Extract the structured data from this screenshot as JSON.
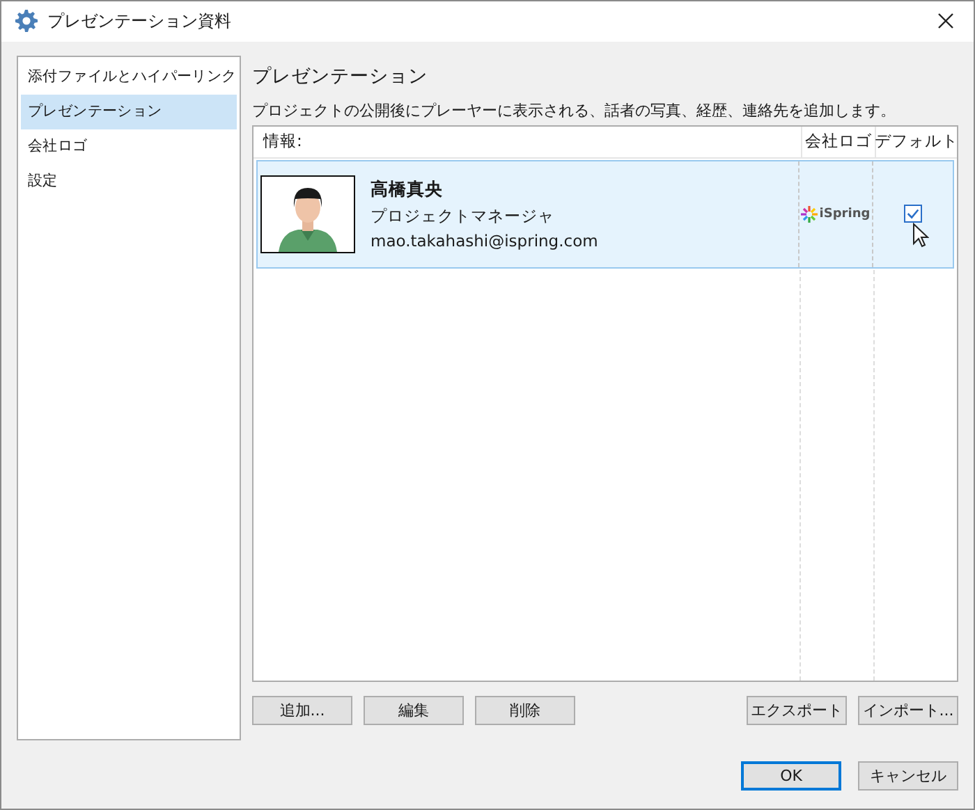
{
  "window": {
    "title": "プレゼンテーション資料"
  },
  "sidebar": {
    "items": [
      {
        "label": "添付ファイルとハイパーリンク",
        "selected": false
      },
      {
        "label": "プレゼンテーション",
        "selected": true
      },
      {
        "label": "会社ロゴ",
        "selected": false
      },
      {
        "label": "設定",
        "selected": false
      }
    ]
  },
  "section": {
    "title": "プレゼンテーション",
    "description": "プロジェクトの公開後にプレーヤーに表示される、話者の写真、経歴、連絡先を追加します。"
  },
  "table": {
    "columns": [
      "情報:",
      "会社ロゴ",
      "デフォルト"
    ],
    "rows": [
      {
        "name": "高橋真央",
        "role": "プロジェクトマネージャ",
        "email": "mao.takahashi@ispring.com",
        "logo": "iSpring",
        "default": true,
        "selected": true
      }
    ]
  },
  "list_buttons": [
    {
      "label": "追加..."
    },
    {
      "label": "編集"
    },
    {
      "label": "削除"
    }
  ],
  "transfer_buttons": [
    {
      "label": "エクスポート"
    },
    {
      "label": "インポート..."
    }
  ],
  "dialog_buttons": [
    {
      "label": "OK",
      "default": true
    },
    {
      "label": "キャンセル",
      "default": false
    }
  ]
}
